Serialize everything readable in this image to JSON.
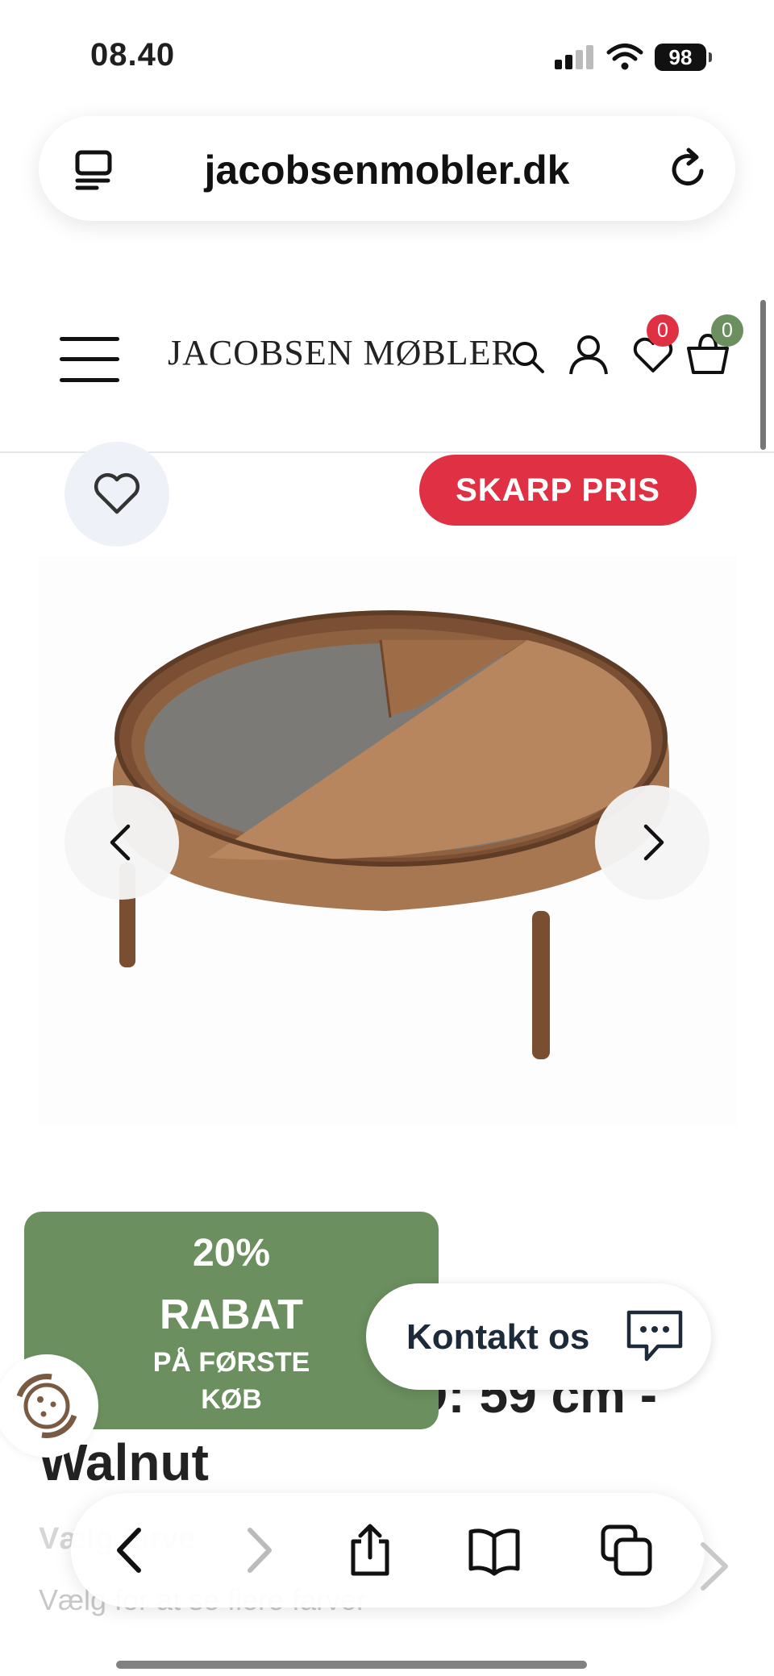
{
  "status_bar": {
    "time": "08.40",
    "battery": "98"
  },
  "browser": {
    "url": "jacobsenmobler.dk"
  },
  "header": {
    "logo": "JACOBSEN MØBLER",
    "wishlist_count": "0",
    "cart_count": "0"
  },
  "product": {
    "badge": "SKARP PRIS",
    "title": "Arc Side Table Ø: 59 cm - Walnut",
    "color_label": "Vælg farve",
    "color_hint": "Vælg for at se flere farver"
  },
  "promo": {
    "line1": "20%",
    "line2": "RABAT",
    "line3": "PÅ FØRSTE",
    "line4": "KØB"
  },
  "contact": {
    "label": "Kontakt os"
  },
  "colors": {
    "badge_red": "#e03144",
    "promo_green": "#6b8f5f",
    "cart_badge_green": "#6b8f5f",
    "wish_badge_red": "#e03144",
    "wood": "#9b6b45"
  },
  "icons": [
    "tabs-icon",
    "reload-icon",
    "menu-icon",
    "search-icon",
    "user-icon",
    "heart-icon",
    "cart-icon",
    "chevron-left-icon",
    "chevron-right-icon",
    "chat-icon",
    "cookie-icon",
    "back-icon",
    "forward-icon",
    "share-icon",
    "bookmarks-icon",
    "tabs-overview-icon"
  ]
}
